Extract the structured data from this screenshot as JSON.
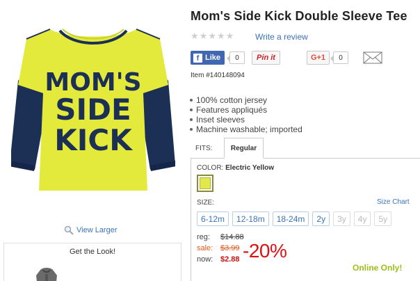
{
  "product": {
    "title": "Mom's Side Kick Double Sleeve Tee",
    "image_text": "MOM'S SIDE KICK",
    "item_number": "Item #140148094",
    "rating_stars": 5,
    "write_review": "Write a review"
  },
  "media": {
    "view_larger": "View Larger",
    "get_the_look": "Get the Look!"
  },
  "social": {
    "like_label": "Like",
    "like_count": "0",
    "pin_label": "Pin it",
    "gplus_label": "G+1",
    "gplus_count": "0",
    "mail_icon": "envelope-icon"
  },
  "features": [
    "100% cotton jersey",
    "Features appliqués",
    "Inset sleeves",
    "Machine washable; imported"
  ],
  "fits": {
    "label": "FITS:",
    "selected": "Regular"
  },
  "color": {
    "label": "COLOR:",
    "selected": "Electric Yellow",
    "swatch_hex": "#e2e84a"
  },
  "size": {
    "label": "SIZE:",
    "chart_link": "Size Chart",
    "options": [
      {
        "label": "6-12m",
        "available": true
      },
      {
        "label": "12-18m",
        "available": true
      },
      {
        "label": "18-24m",
        "available": true
      },
      {
        "label": "2y",
        "available": true
      },
      {
        "label": "3y",
        "available": false
      },
      {
        "label": "4y",
        "available": false
      },
      {
        "label": "5y",
        "available": false
      }
    ]
  },
  "price": {
    "reg_label": "reg:",
    "reg_value": "$14.88",
    "sale_label": "sale:",
    "sale_value": "$3.99",
    "now_label": "now:",
    "now_value": "$2.88",
    "discount": "-20%",
    "online_only": "Online Only!"
  },
  "colors": {
    "link": "#3b73b9",
    "facebook": "#4267b2",
    "sale": "#e05a1b",
    "discount": "#dd1111",
    "online_only": "#9bbf1a",
    "shirt_body": "#e3ea3c",
    "shirt_sleeves": "#1c2f55"
  }
}
